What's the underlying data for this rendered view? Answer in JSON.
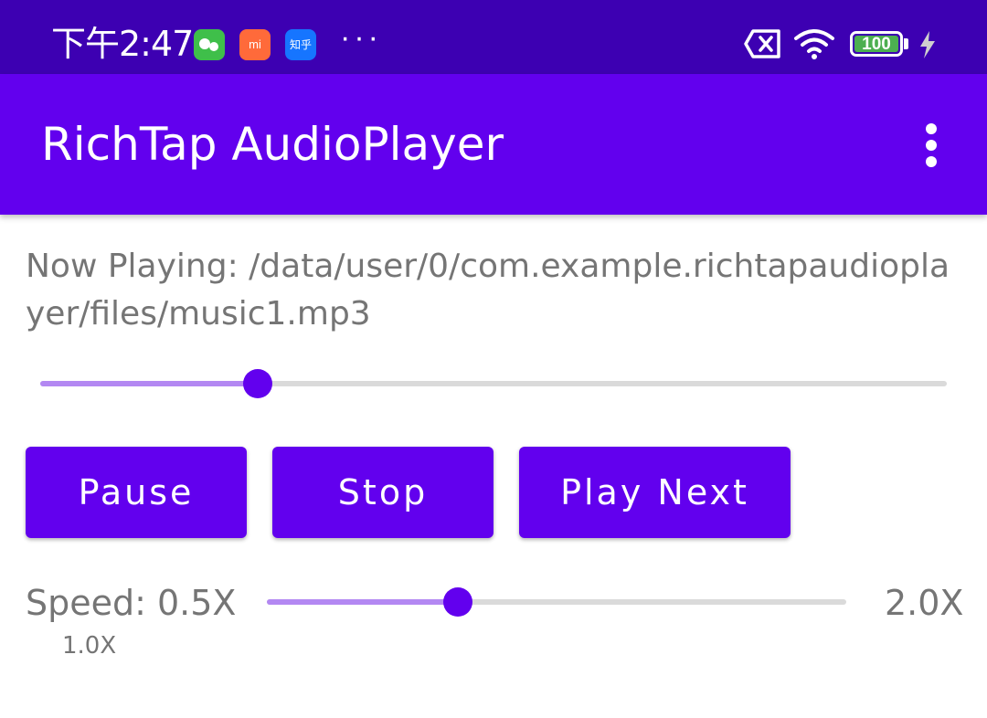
{
  "status_bar": {
    "time": "下午2:47",
    "app_badges": [
      "wechat-icon",
      "mi-store-icon",
      "zhihu-icon"
    ],
    "zhihu_label": "知乎",
    "mi_label": "mi",
    "more_indicator": "···",
    "battery_level": "100",
    "icons": [
      "sim-off-icon",
      "wifi-icon",
      "battery-icon",
      "charging-icon"
    ]
  },
  "app_bar": {
    "title": "RichTap AudioPlayer",
    "menu_icon": "more-vert-icon"
  },
  "player": {
    "now_playing": "Now Playing: /data/user/0/com.example.richtapaudioplayer/files/music1.mp3",
    "progress_fraction": 0.24
  },
  "controls": {
    "pause_label": "Pause",
    "stop_label": "Stop",
    "play_next_label": "Play Next"
  },
  "speed": {
    "min_label": "Speed: 0.5X",
    "max_label": "2.0X",
    "current_label": "1.0X",
    "slider_fraction": 0.33
  },
  "colors": {
    "primary": "#6200ee",
    "primary_dark": "#3d00b2",
    "slider_fill": "#b388f2",
    "slider_track": "#dadada",
    "text_secondary": "#757575"
  }
}
